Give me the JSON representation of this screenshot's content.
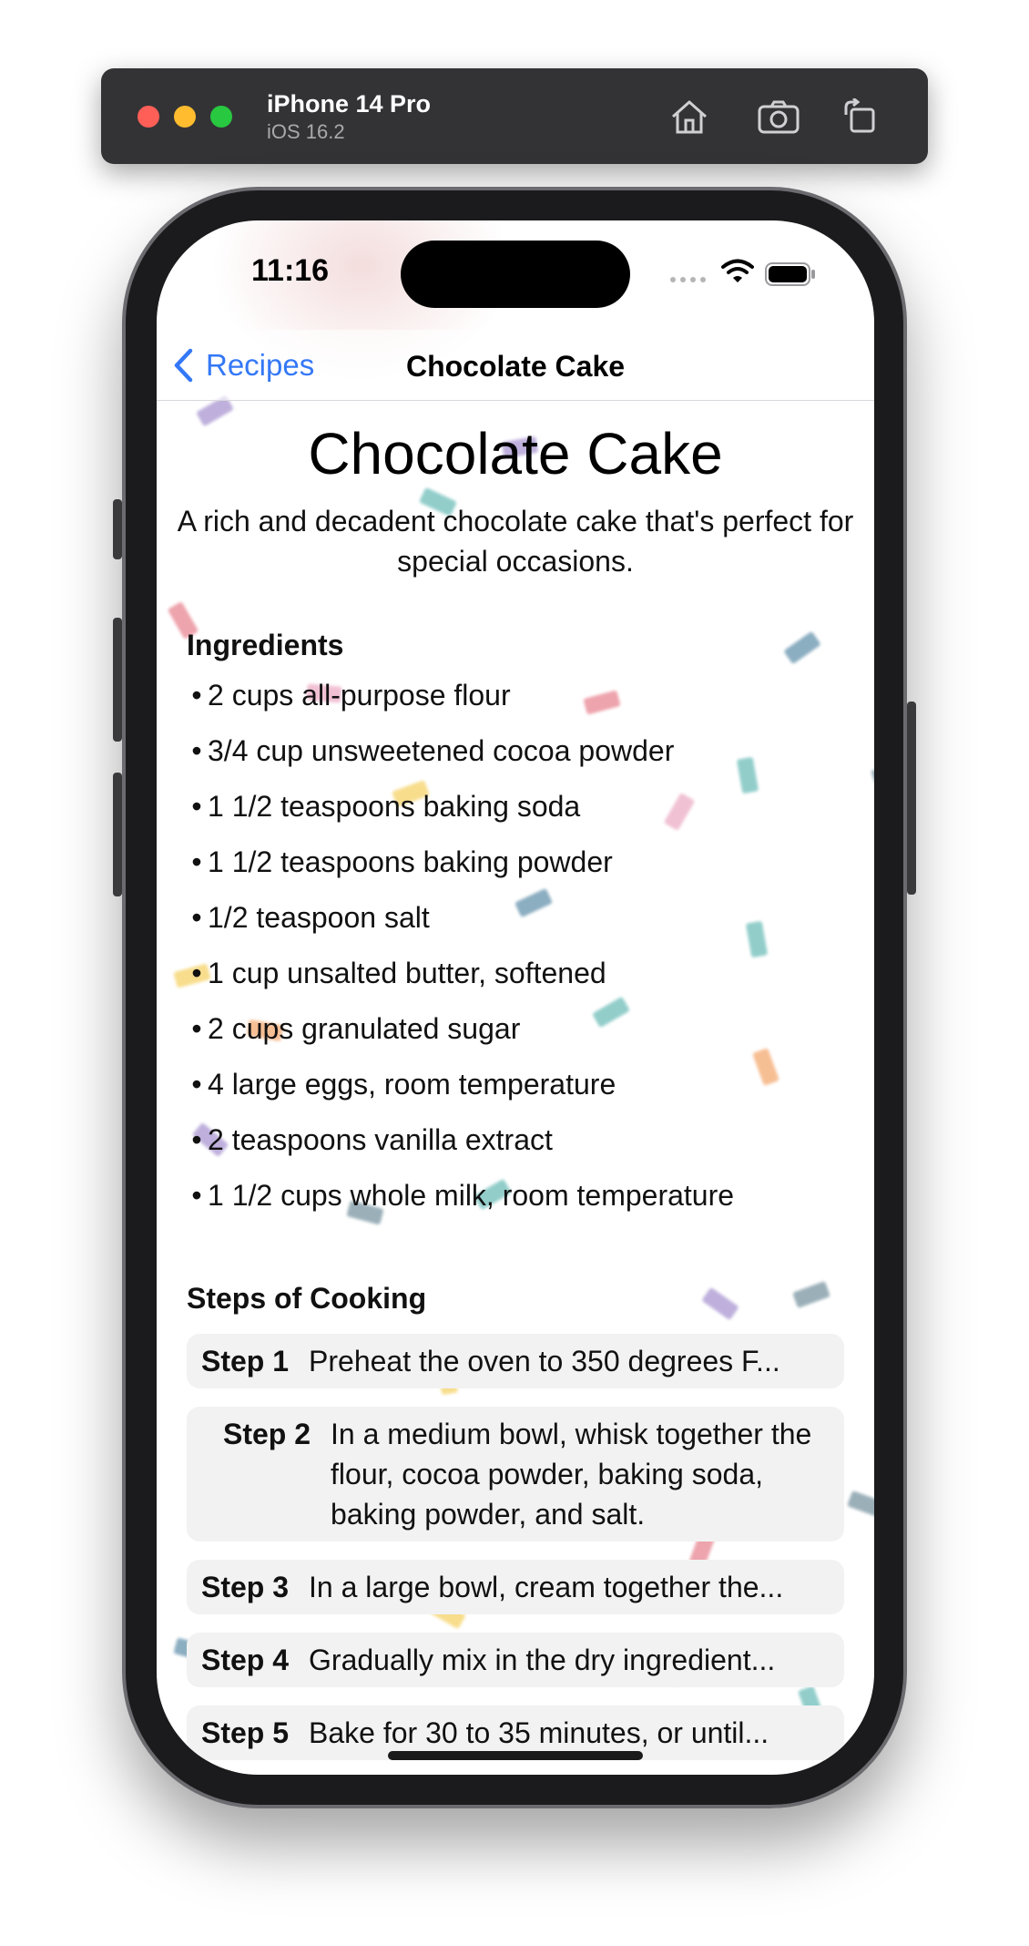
{
  "simulator": {
    "device_name": "iPhone 14 Pro",
    "os_version": "iOS 16.2",
    "icons": [
      "home-icon",
      "screenshot-icon",
      "rotate-icon"
    ]
  },
  "status_bar": {
    "time": "11:16",
    "icons": [
      "cellular-dots-icon",
      "wifi-icon",
      "battery-icon"
    ]
  },
  "nav": {
    "back_label": "Recipes",
    "title": "Chocolate Cake"
  },
  "recipe": {
    "title": "Chocolate Cake",
    "description": "A rich and decadent chocolate cake that's perfect for special occasions.",
    "ingredients_heading": "Ingredients",
    "ingredients": [
      "2 cups all-purpose flour",
      "3/4 cup unsweetened cocoa powder",
      "1 1/2 teaspoons baking soda",
      "1 1/2 teaspoons baking powder",
      "1/2 teaspoon salt",
      "1 cup unsalted butter, softened",
      "2 cups granulated sugar",
      "4 large eggs, room temperature",
      "2 teaspoons vanilla extract",
      "1 1/2 cups whole milk, room temperature"
    ],
    "bullet": "•",
    "steps_heading": "Steps of Cooking",
    "steps": [
      {
        "label": "Step 1",
        "text": "Preheat the oven to 350 degrees F..."
      },
      {
        "label": "Step 2",
        "text": "In a medium bowl, whisk together the flour, cocoa powder, baking soda, baking powder, and salt."
      },
      {
        "label": "Step 3",
        "text": "In a large bowl, cream together the..."
      },
      {
        "label": "Step 4",
        "text": "Gradually mix in the dry ingredient..."
      },
      {
        "label": "Step 5",
        "text": "Bake for 30 to 35 minutes, or until..."
      }
    ]
  },
  "colors": {
    "accent": "#3478f6",
    "step_background": "#f2f2f3",
    "confetti": [
      "#e05a6a",
      "#f2c230",
      "#3aa6a0",
      "#8a6fc0",
      "#f08a3c",
      "#e58fb0",
      "#2e6c8f",
      "#4a6f80"
    ]
  }
}
